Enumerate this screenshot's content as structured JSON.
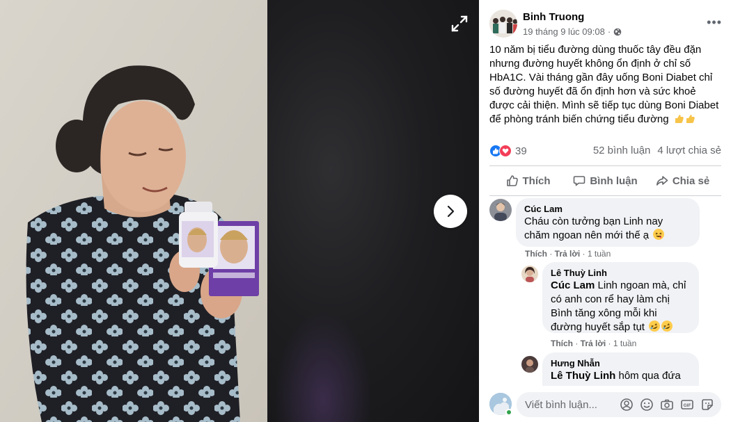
{
  "post": {
    "author": "Binh Truong",
    "date": "19 tháng 9 lúc 09:08",
    "privacy_icon": "globe-icon",
    "text": "10 năm bị tiểu đường dùng thuốc tây đều đặn nhưng đường huyết không ổn định ở chỉ số HbA1C. Vài tháng gần đây uống Boni Diabet chỉ số đường huyết đã ổn định hơn và sức khoẻ được cải thiện. Mình sẽ tiếp tục dùng Boni Diabet để phòng tránh biến chứng tiểu đường",
    "reaction_count": "39",
    "comment_count": "52 bình luận",
    "share_count": "4 lượt chia sẻ"
  },
  "actions": {
    "like": "Thích",
    "comment": "Bình luận",
    "share": "Chia sẻ"
  },
  "comments": [
    {
      "name": "Cúc Lam",
      "text": "Cháu còn tưởng bạn Linh nay chăm ngoan nên mới thế ạ",
      "like": "Thích",
      "reply": "Trả lời",
      "time": "1 tuần"
    },
    {
      "name": "Lê Thuỳ Linh",
      "tag": "Cúc Lam",
      "text": " Linh ngoan mà, chỉ có anh con rể hay làm chị Bình tăng xông mỗi khi đường huyết sắp tụt",
      "like": "Thích",
      "reply": "Trả lời",
      "time": "1 tuần"
    },
    {
      "name": "Hưng Nhẫn",
      "tag": "Lê Thuỳ Linh",
      "text": " hôm qua đứa"
    }
  ],
  "composer": {
    "placeholder": "Viết bình luận..."
  },
  "colors": {
    "like_blue": "#1877f2",
    "love_red": "#f33e58",
    "viewer_bg": "#0c0c0d"
  }
}
